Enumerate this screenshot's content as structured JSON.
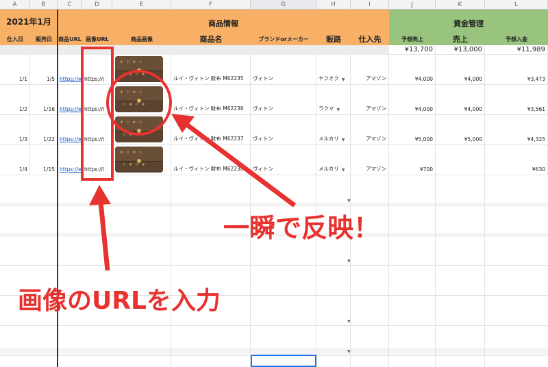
{
  "columns": [
    "A",
    "B",
    "C",
    "D",
    "E",
    "F",
    "G",
    "H",
    "I",
    "J",
    "K",
    "L"
  ],
  "title_cell": "2021年1月",
  "group_product": "商品情報",
  "group_finance": "資金管理",
  "headers": {
    "purchase_date": "仕入日",
    "sale_date": "販売日",
    "product_url": "商品URL",
    "image_url": "画像URL",
    "product_image": "商品画像",
    "product_name": "商品名",
    "brand": "ブランドorメーカー",
    "channel": "販路",
    "supplier": "仕入先",
    "expected_sales": "予想売上",
    "sales": "売上",
    "expected_deposit": "予想入金"
  },
  "totals": {
    "expected_sales": "¥13,700",
    "sales": "¥13,000",
    "expected_deposit": "¥11,989"
  },
  "rows": [
    {
      "purchase_date": "1/1",
      "sale_date": "1/5",
      "product_url": "https://w",
      "image_url": "https://i",
      "name": "ルイ・ヴィトン 財布 M62235",
      "brand": "ヴィトン",
      "channel": "ヤフオク",
      "supplier": "アマゾン",
      "expected_sales": "¥4,000",
      "sales": "¥4,000",
      "deposit": "¥3,473"
    },
    {
      "purchase_date": "1/2",
      "sale_date": "1/16",
      "product_url": "https://w",
      "image_url": "https://i",
      "name": "ルイ・ヴィトン 財布 M62236",
      "brand": "ヴィトン",
      "channel": "ラクマ",
      "supplier": "アマゾン",
      "expected_sales": "¥4,000",
      "sales": "¥4,000",
      "deposit": "¥3,561"
    },
    {
      "purchase_date": "1/3",
      "sale_date": "1/22",
      "product_url": "https://w",
      "image_url": "https://i",
      "name": "ルイ・ヴィトン 財布 M62237",
      "brand": "ヴィトン",
      "channel": "メルカリ",
      "supplier": "アマゾン",
      "expected_sales": "¥5,000",
      "sales": "¥5,000",
      "deposit": "¥4,325"
    },
    {
      "purchase_date": "1/4",
      "sale_date": "1/15",
      "product_url": "https://w",
      "image_url": "https://i",
      "name": "ルイ・ヴィトン 財布 M62238",
      "brand": "ヴィトン",
      "channel": "メルカリ",
      "supplier": "アマゾン",
      "expected_sales": "¥700",
      "sales": "",
      "deposit": "¥630"
    }
  ],
  "annotations": {
    "reflect": "一瞬で反映！",
    "input_url": "画像のURLを入力"
  },
  "colors": {
    "orange_header": "#f7b065",
    "green_header": "#98c47d",
    "annotation_red": "#e8322f",
    "link": "#1155cc"
  }
}
